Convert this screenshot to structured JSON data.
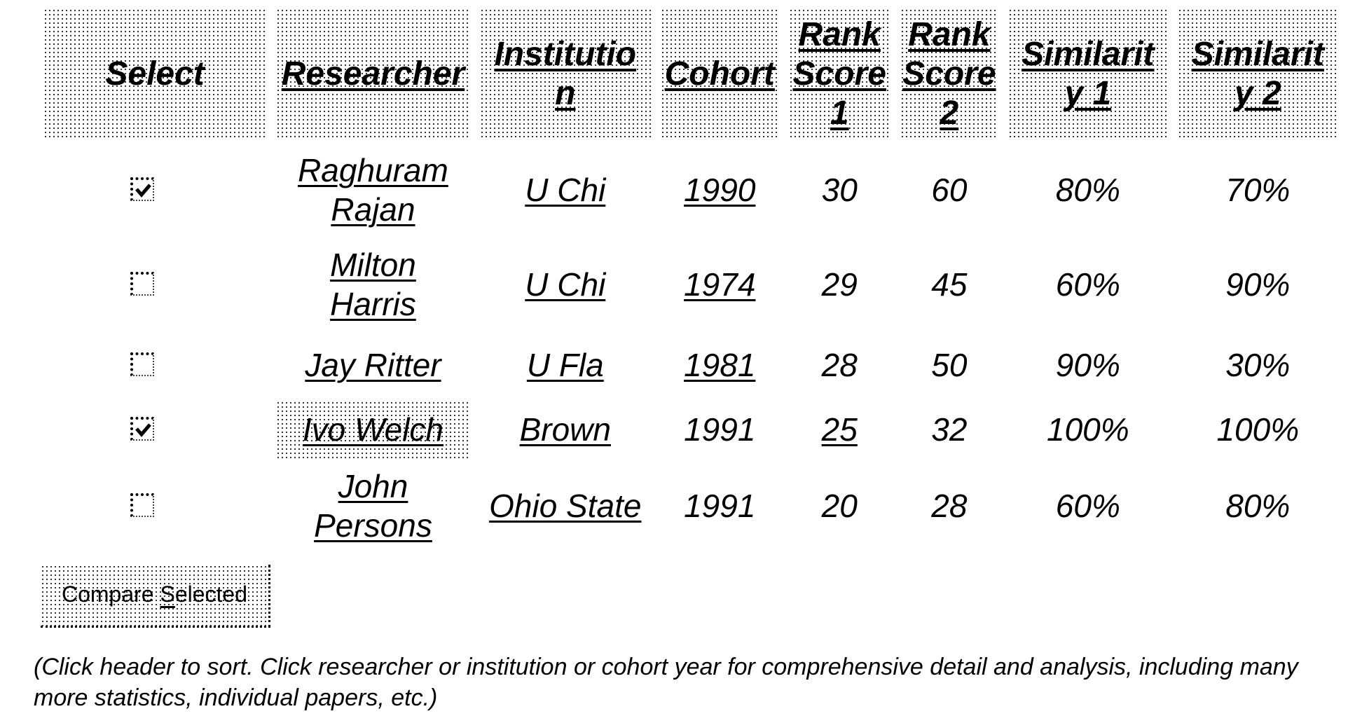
{
  "table": {
    "headers": [
      {
        "key": "select",
        "label": "Select",
        "sortable": false
      },
      {
        "key": "researcher",
        "label": "Researcher",
        "sortable": true
      },
      {
        "key": "institution",
        "label": "Institution",
        "sortable": true
      },
      {
        "key": "cohort",
        "label": "Cohort",
        "sortable": true
      },
      {
        "key": "rank_score_1",
        "label": "Rank Score 1",
        "sortable": true
      },
      {
        "key": "rank_score_2",
        "label": "Rank Score 2",
        "sortable": true
      },
      {
        "key": "similarity_1",
        "label": "Similarity 1",
        "sortable": true
      },
      {
        "key": "similarity_2",
        "label": "Similarity 2",
        "sortable": true
      }
    ],
    "rows": [
      {
        "selected": true,
        "researcher": "Raghuram Rajan",
        "institution": "U Chi",
        "cohort": "1990",
        "rank_score_1": "30",
        "rank_score_2": "60",
        "similarity_1": "80%",
        "similarity_2": "70%"
      },
      {
        "selected": false,
        "researcher": "Milton Harris",
        "institution": "U Chi",
        "cohort": "1974",
        "rank_score_1": "29",
        "rank_score_2": "45",
        "similarity_1": "60%",
        "similarity_2": "90%"
      },
      {
        "selected": false,
        "researcher": "Jay Ritter",
        "institution": "U Fla",
        "cohort": "1981",
        "rank_score_1": "28",
        "rank_score_2": "50",
        "similarity_1": "90%",
        "similarity_2": "30%"
      },
      {
        "selected": true,
        "researcher": "Ivo Welch",
        "institution": "Brown",
        "cohort": "1991",
        "rank_score_1": "25",
        "rank_score_2": "32",
        "similarity_1": "100%",
        "similarity_2": "100%",
        "highlighted": true
      },
      {
        "selected": false,
        "researcher": "John Persons",
        "institution": "Ohio State",
        "cohort": "1991",
        "rank_score_1": "20",
        "rank_score_2": "28",
        "similarity_1": "60%",
        "similarity_2": "80%"
      }
    ]
  },
  "compare_button": {
    "label_prefix": "Compare ",
    "label_accel": "S",
    "label_suffix": "elected"
  },
  "footnote": "(Click header to sort. Click researcher or institution or cohort year for comprehensive detail and analysis, including many more statistics, individual papers, etc.)"
}
